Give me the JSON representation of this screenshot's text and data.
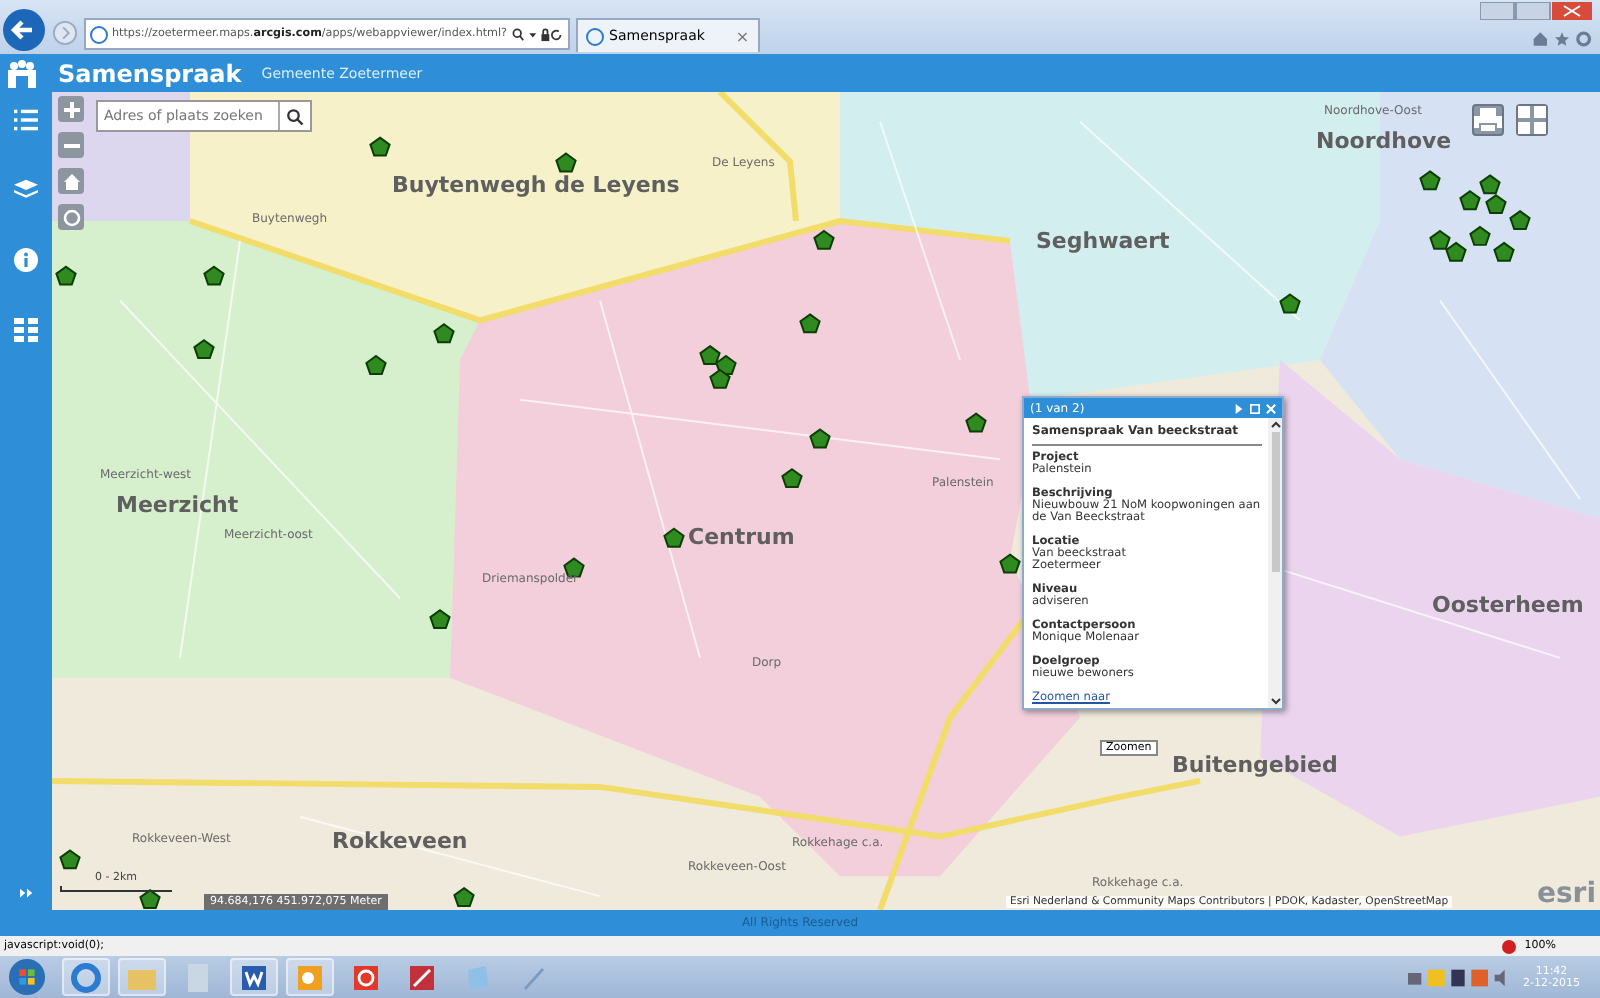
{
  "browser": {
    "address": "https://zoetermeer.maps.**arcgis.com**/apps/webappviewer/index.html?",
    "tab": {
      "title": "Samenspraak",
      "close": "×"
    }
  },
  "app": {
    "title": "Samenspraak",
    "subtitle": "Gemeente Zoetermeer"
  },
  "search": {
    "placeholder": "Adres of plaats zoeken"
  },
  "map": {
    "labels": [
      {
        "text": "Buytenwegh de Leyens",
        "kind": "district"
      },
      {
        "text": "Buytenwegh",
        "kind": "area"
      },
      {
        "text": "De Leyens",
        "kind": "area"
      },
      {
        "text": "Noordhove",
        "kind": "district"
      },
      {
        "text": "Seghwaert",
        "kind": "district"
      },
      {
        "text": "Meerzicht-west",
        "kind": "area"
      },
      {
        "text": "Meerzicht",
        "kind": "district"
      },
      {
        "text": "Meerzicht-oost",
        "kind": "area"
      },
      {
        "text": "Centrum",
        "kind": "district"
      },
      {
        "text": "Palenstein",
        "kind": "area"
      },
      {
        "text": "Driemanspolder",
        "kind": "area"
      },
      {
        "text": "Oosterheem",
        "kind": "district"
      },
      {
        "text": "Buitengebied",
        "kind": "district"
      },
      {
        "text": "Rokkeveen-West",
        "kind": "area"
      },
      {
        "text": "Rokkeveen",
        "kind": "district"
      },
      {
        "text": "Rokkeveen-Oost",
        "kind": "area"
      },
      {
        "text": "Rokkehage c.a.",
        "kind": "area"
      },
      {
        "text": "Rokkehage c.a.",
        "kind": "area"
      },
      {
        "text": "Dorp",
        "kind": "area"
      },
      {
        "text": "Noordhove-Oost",
        "kind": "area"
      }
    ],
    "scale": "0 - 2km",
    "coordinates": "94.684,176 451.972,075 Meter",
    "attribution": "Esri Nederland & Community Maps Contributors | PDOK, Kadaster, OpenStreetMap",
    "logo": "esri"
  },
  "popup": {
    "counter": "(1 van 2)",
    "title": "Samenspraak Van beeckstraat",
    "fields": [
      {
        "label": "Project",
        "lines": [
          "Palenstein"
        ]
      },
      {
        "label": "Beschrijving",
        "lines": [
          "Nieuwbouw 21 NoM koopwoningen aan de Van Beeckstraat"
        ]
      },
      {
        "label": "Locatie",
        "lines": [
          "Van beeckstraat",
          "Zoetermeer"
        ]
      },
      {
        "label": "Niveau",
        "lines": [
          "adviseren"
        ]
      },
      {
        "label": "Contactpersoon",
        "lines": [
          "Monique Molenaar"
        ]
      },
      {
        "label": "Doelgroep",
        "lines": [
          "nieuwe bewoners"
        ]
      }
    ],
    "link": "Zoomen naar",
    "tooltip": "Zoomen"
  },
  "footer": "All Rights Reserved",
  "status": {
    "text": "javascript:void(0);",
    "zoom": "100%"
  },
  "clock": {
    "time": "11:42",
    "date": "2-12-2015"
  }
}
